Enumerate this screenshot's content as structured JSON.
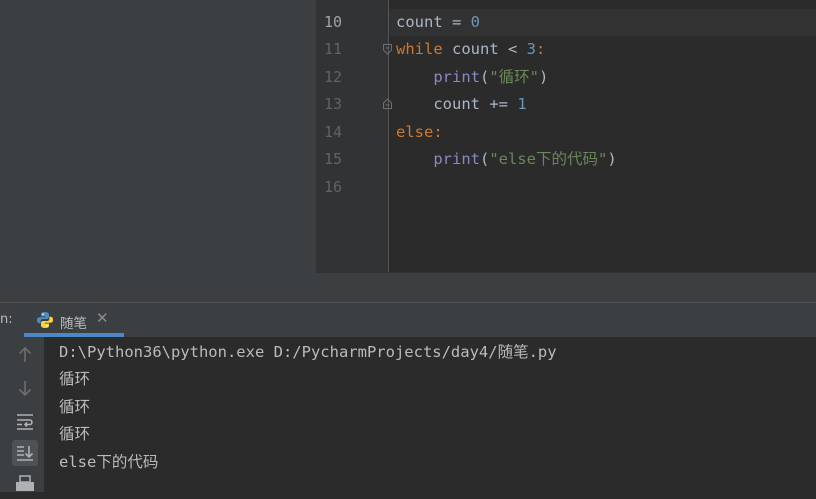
{
  "editor": {
    "line_numbers": [
      "10",
      "11",
      "12",
      "13",
      "14",
      "15",
      "16"
    ],
    "current_line": "10",
    "code": {
      "l10_var": "count",
      "l10_op": " = ",
      "l10_num": "0",
      "l11_kw": "while",
      "l11_rest": " count < ",
      "l11_num": "3",
      "l11_colon": ":",
      "l12_indent": "    ",
      "l12_fn": "print",
      "l12_open": "(",
      "l12_str": "\"循环\"",
      "l12_close": ")",
      "l13_code": "    count += ",
      "l13_num": "1",
      "l14_kw": "else",
      "l14_colon": ":",
      "l15_indent": "    ",
      "l15_fn": "print",
      "l15_open": "(",
      "l15_str": "\"else下的代码\"",
      "l15_close": ")"
    }
  },
  "run_panel": {
    "label": "n:",
    "tab": {
      "label": "随笔",
      "close": "✕",
      "icon": "python-icon"
    },
    "toolbar_icons": [
      "arrow-up-icon",
      "arrow-down-icon",
      "soft-wrap-icon",
      "scroll-to-end-icon",
      "print-icon"
    ],
    "output": [
      "D:\\Python36\\python.exe D:/PycharmProjects/day4/随笔.py",
      "循环",
      "循环",
      "循环",
      "else下的代码"
    ]
  },
  "colors": {
    "keyword": "#cc7832",
    "number": "#6897bb",
    "builtin": "#8888c6",
    "string": "#6a8759",
    "accent": "#4a88c7"
  }
}
